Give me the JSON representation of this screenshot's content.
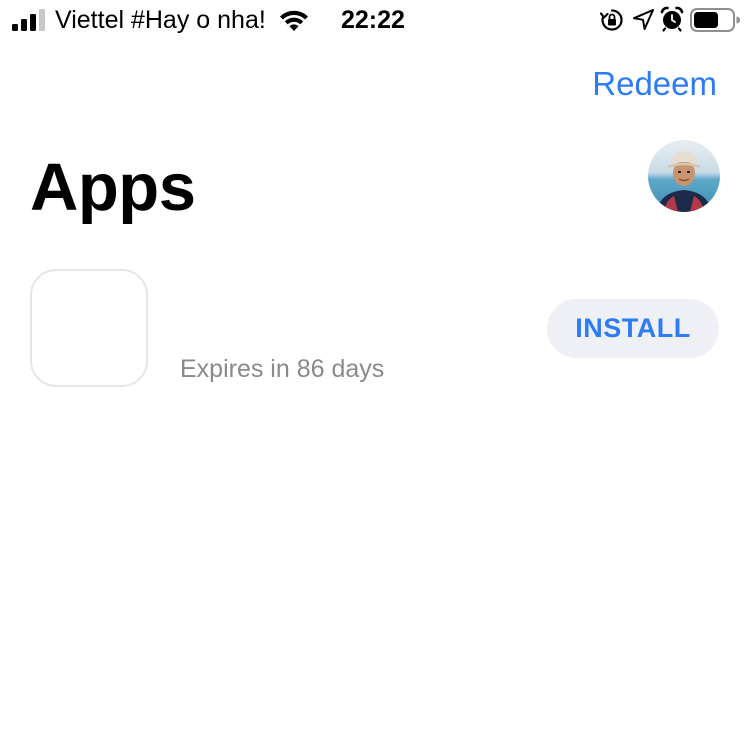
{
  "status_bar": {
    "carrier": "Viettel #Hay o nha!",
    "time": "22:22",
    "signal_icon": "cellular-signal-icon",
    "wifi_icon": "wifi-icon",
    "icons": [
      "rotation-lock-icon",
      "location-arrow-icon",
      "alarm-clock-icon",
      "battery-icon"
    ],
    "battery_level": 0.65
  },
  "header": {
    "redeem_label": "Redeem",
    "title": "Apps"
  },
  "apps": [
    {
      "subtitle": "Expires in 86 days",
      "action_label": "INSTALL"
    }
  ],
  "colors": {
    "accent": "#2d7cf6",
    "button_bg": "#eff0f5",
    "secondary_text": "#8a8a8e"
  }
}
